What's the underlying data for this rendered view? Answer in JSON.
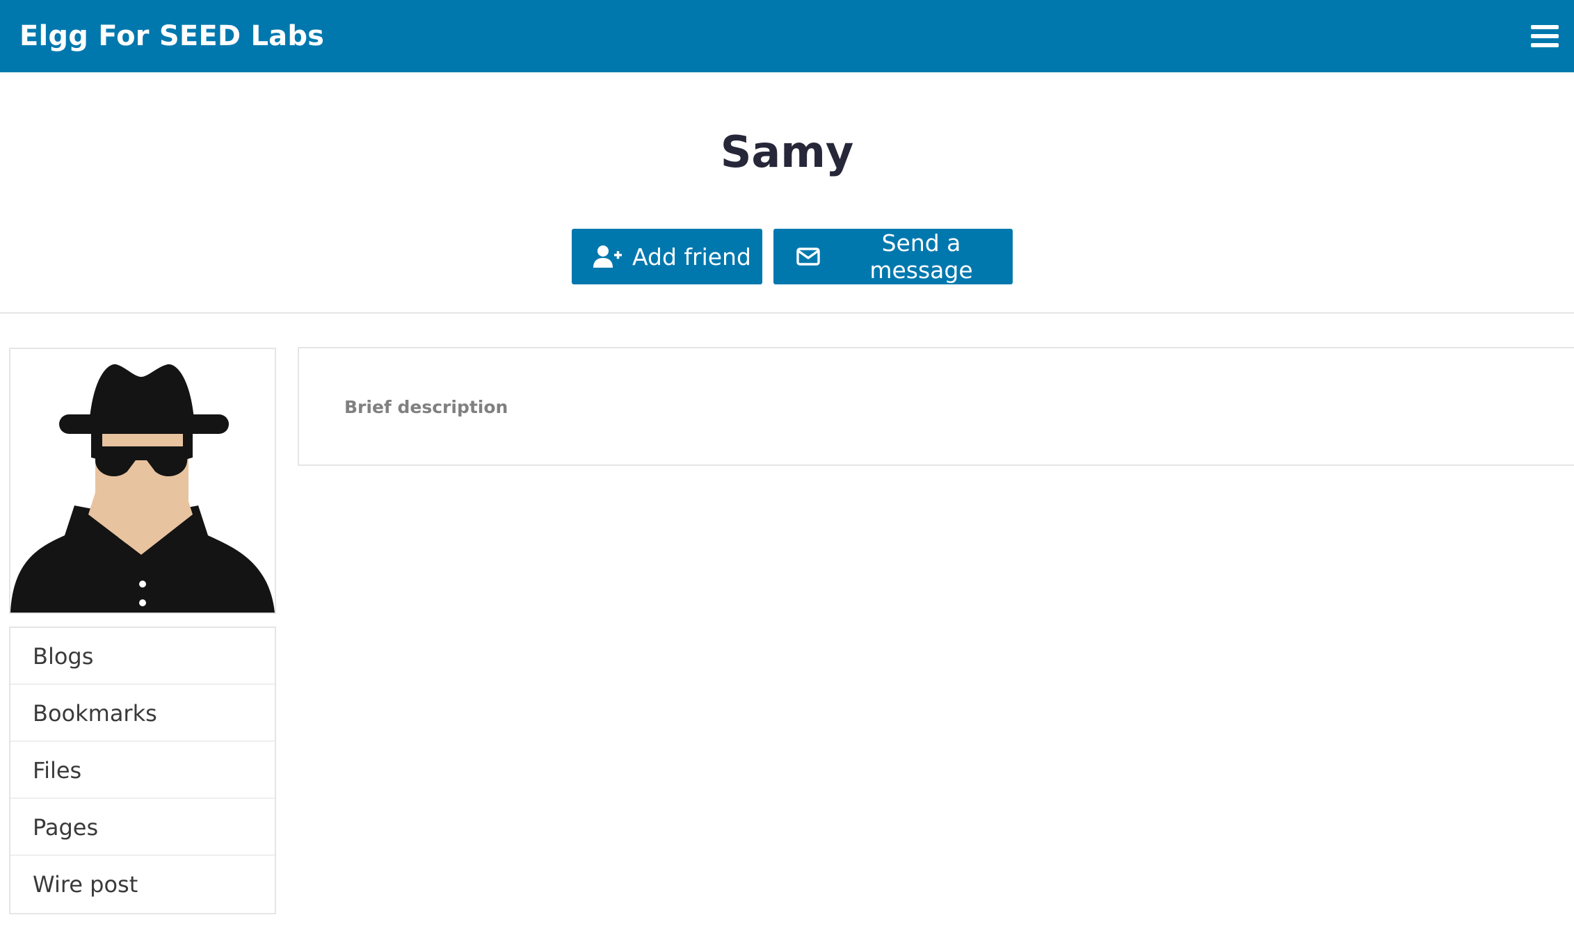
{
  "topbar": {
    "site_title": "Elgg For SEED Labs",
    "menu_icon": "hamburger-menu-icon",
    "background_color": "#0078ae"
  },
  "profile": {
    "name": "Samy",
    "actions": {
      "add_friend_label": "Add friend",
      "add_friend_icon": "user-plus-icon",
      "send_message_label": "Send a message",
      "send_message_icon": "envelope-icon"
    },
    "avatar_icon": "spy-avatar-icon",
    "details": {
      "brief_description_label": "Brief description"
    }
  },
  "sidebar": {
    "items": [
      {
        "label": "Blogs"
      },
      {
        "label": "Bookmarks"
      },
      {
        "label": "Files"
      },
      {
        "label": "Pages"
      },
      {
        "label": "Wire post"
      }
    ]
  },
  "colors": {
    "accent": "#0078ae",
    "heading": "#27273a",
    "muted": "#808080",
    "border": "#e5e5e5"
  }
}
